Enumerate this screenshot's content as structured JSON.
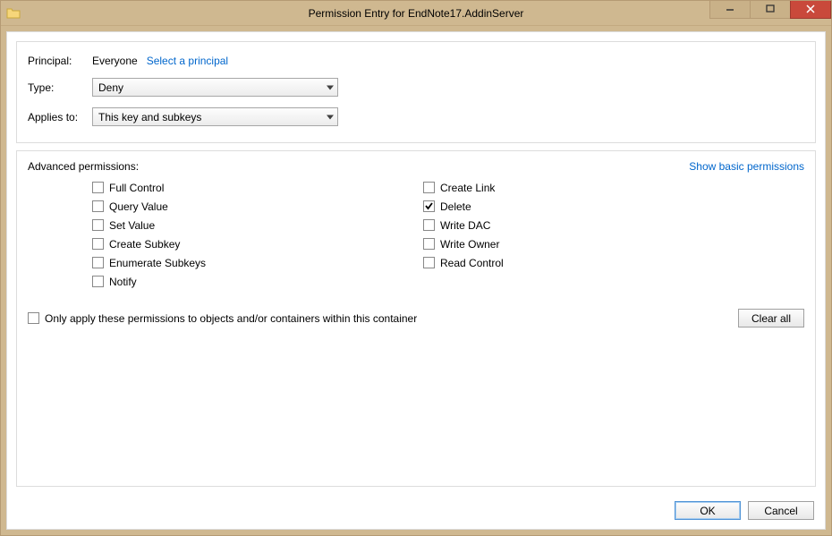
{
  "window": {
    "title": "Permission Entry for EndNote17.AddinServer"
  },
  "principal": {
    "label": "Principal:",
    "value": "Everyone",
    "select_link": "Select a principal"
  },
  "type": {
    "label": "Type:",
    "value": "Deny"
  },
  "applies": {
    "label": "Applies to:",
    "value": "This key and subkeys"
  },
  "perms": {
    "heading": "Advanced permissions:",
    "toggle_link": "Show basic permissions",
    "left": [
      {
        "label": "Full Control",
        "checked": false
      },
      {
        "label": "Query Value",
        "checked": false
      },
      {
        "label": "Set Value",
        "checked": false
      },
      {
        "label": "Create Subkey",
        "checked": false
      },
      {
        "label": "Enumerate Subkeys",
        "checked": false
      },
      {
        "label": "Notify",
        "checked": false
      }
    ],
    "right": [
      {
        "label": "Create Link",
        "checked": false
      },
      {
        "label": "Delete",
        "checked": true
      },
      {
        "label": "Write DAC",
        "checked": false
      },
      {
        "label": "Write Owner",
        "checked": false
      },
      {
        "label": "Read Control",
        "checked": false
      }
    ],
    "only_apply": {
      "label": "Only apply these permissions to objects and/or containers within this container",
      "checked": false
    },
    "clear_all": "Clear all"
  },
  "buttons": {
    "ok": "OK",
    "cancel": "Cancel"
  }
}
